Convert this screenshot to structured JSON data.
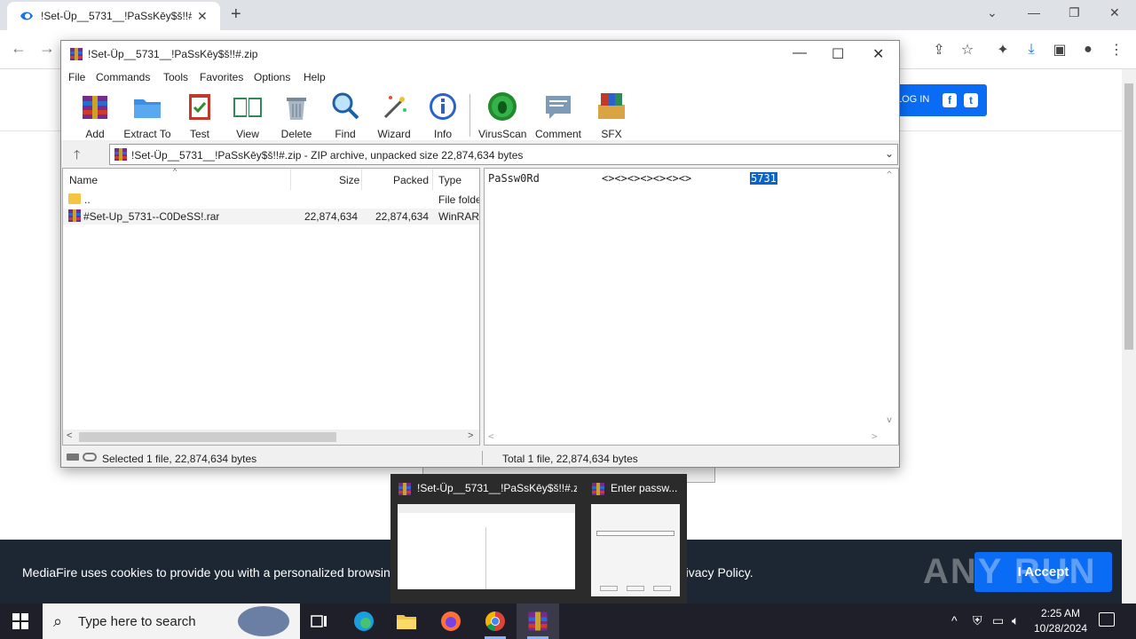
{
  "browser": {
    "tab_title": "!Set-Üp__5731__!PaSsKēy$š!!#",
    "page": {
      "login_label": "LOG IN",
      "social": [
        "f",
        "t"
      ]
    },
    "cookie_banner": {
      "text_before": "MediaFire uses cookies to provide you with a personalized browsing expe",
      "text_after": "rivacy Policy.",
      "accept_label": "I Accept",
      "watermark": "ANY RUN"
    }
  },
  "winrar": {
    "title": "!Set-Üp__5731__!PaSsKēy$š!!#.zip",
    "menu": [
      "File",
      "Commands",
      "Tools",
      "Favorites",
      "Options",
      "Help"
    ],
    "toolbar": [
      "Add",
      "Extract To",
      "Test",
      "View",
      "Delete",
      "Find",
      "Wizard",
      "Info",
      "VirusScan",
      "Comment",
      "SFX"
    ],
    "path": "!Set-Üp__5731__!PaSsKēy$š!!#.zip - ZIP archive, unpacked size 22,874,634 bytes",
    "columns": [
      "Name",
      "Size",
      "Packed",
      "Type"
    ],
    "rows": [
      {
        "name": "..",
        "size": "",
        "packed": "",
        "type": "File folde"
      },
      {
        "name": "#Set-Up_5731--C0DeSS!.rar",
        "size": "22,874,634",
        "packed": "22,874,634",
        "type": "WinRAR"
      }
    ],
    "preview": {
      "label": "PaSsw0Rd",
      "arrows": "<><><><><><><>",
      "value": "5731"
    },
    "status_left": "Selected 1 file, 22,874,634 bytes",
    "status_right": "Total 1 file, 22,874,634 bytes",
    "behind_dialog_buttons": [
      "OK",
      "Cancel",
      "Help"
    ]
  },
  "thumbnails": [
    {
      "title": "!Set-Üp__5731__!PaSsKēy$š!!#.zip"
    },
    {
      "title": "Enter passw..."
    }
  ],
  "taskbar": {
    "search_placeholder": "Type here to search",
    "time": "2:25 AM",
    "date": "10/28/2024"
  },
  "colors": {
    "accent_blue": "#0a6cf5",
    "taskbar": "#1f1f2a",
    "cookie_bg": "#1d2733",
    "highlight": "#0a64c8"
  }
}
